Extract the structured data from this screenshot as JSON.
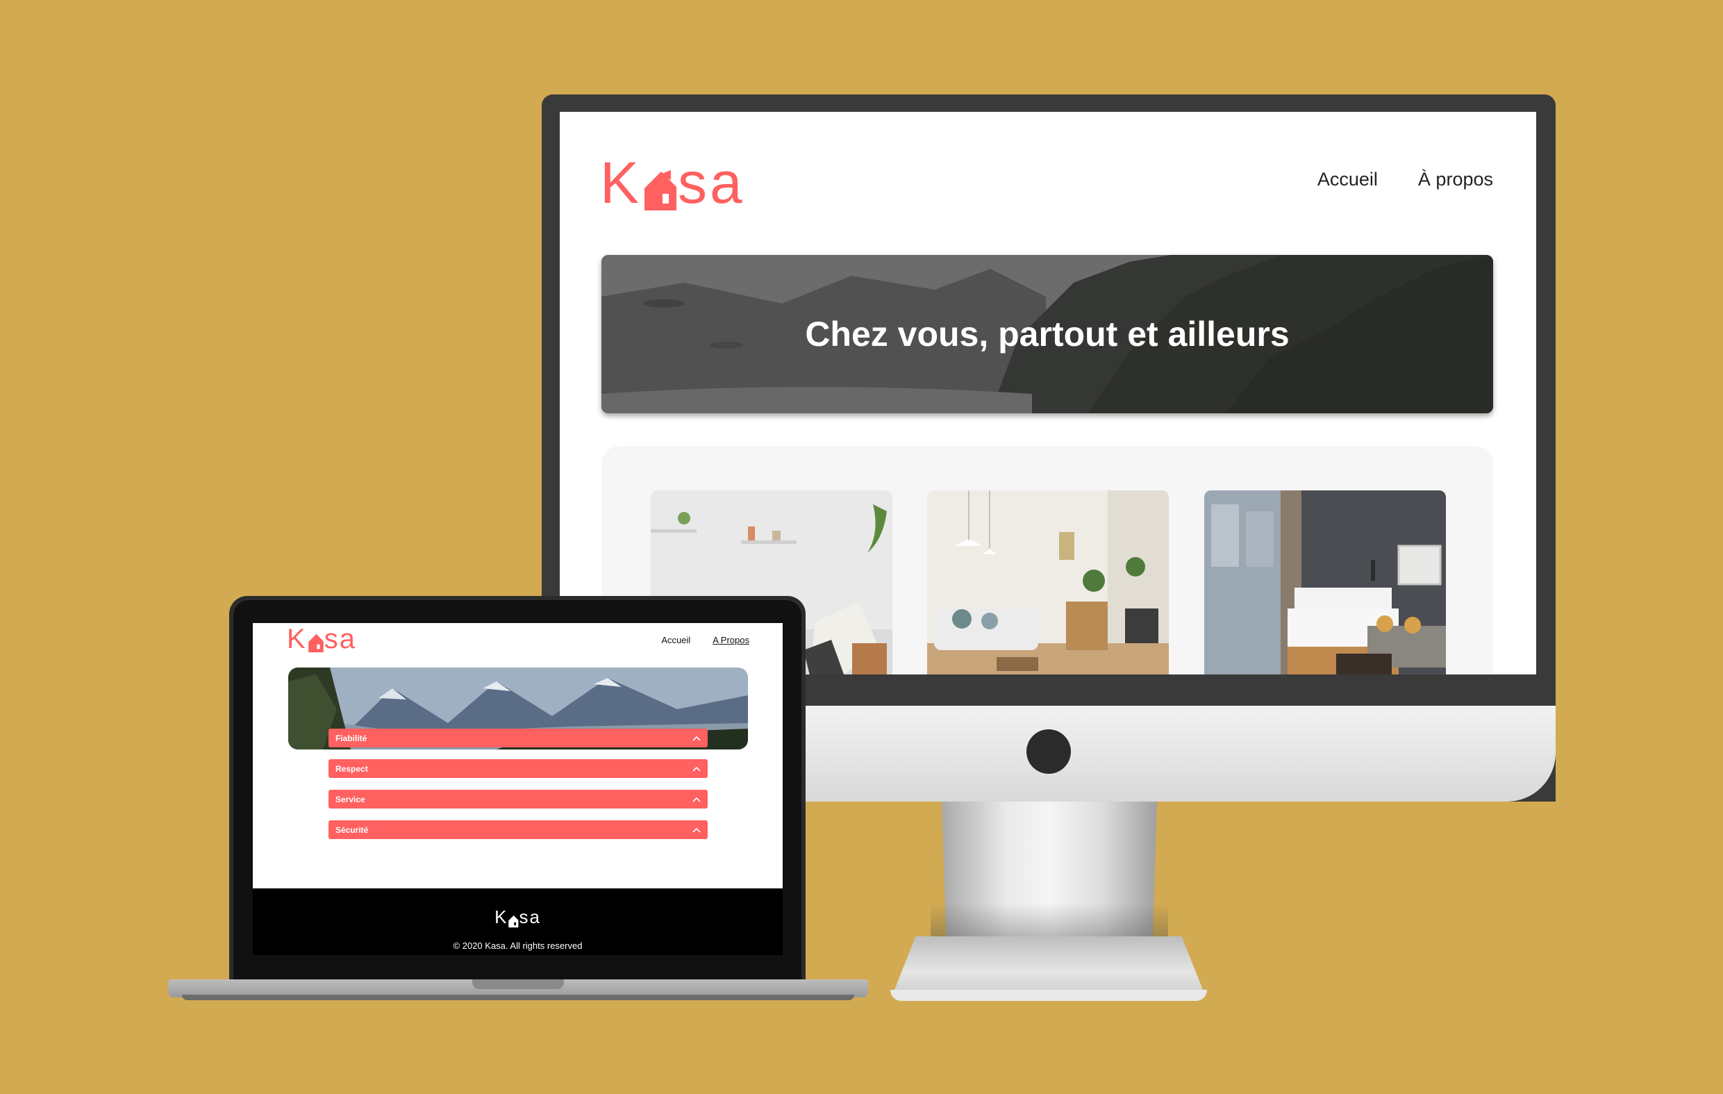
{
  "background_color": "#d2aa52",
  "brand": {
    "name_prefix": "K",
    "name_suffix": "sa",
    "color": "#ff6060"
  },
  "desktop": {
    "nav": [
      {
        "label": "Accueil"
      },
      {
        "label": "À propos"
      }
    ],
    "banner_title": "Chez vous, partout et ailleurs"
  },
  "laptop": {
    "nav": [
      {
        "label": "Accueil",
        "active": false
      },
      {
        "label": "A Propos",
        "active": true
      }
    ],
    "accordion": [
      {
        "label": "Fiabilité"
      },
      {
        "label": "Respect"
      },
      {
        "label": "Service"
      },
      {
        "label": "Sécurité"
      }
    ],
    "footer_copyright": "© 2020 Kasa. All rights reserved"
  }
}
